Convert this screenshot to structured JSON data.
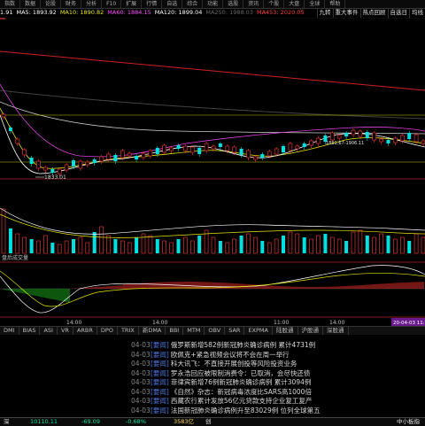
{
  "topbar": {
    "items": [
      "指数",
      "数据",
      "论股",
      "财务",
      "分析",
      "F10",
      "扩展",
      "行情",
      "自选",
      "综合",
      "功能",
      "选股",
      "资讯",
      "个股",
      "大盘",
      "全球",
      "帮助"
    ]
  },
  "ma_bar": {
    "items": [
      {
        "text": "1.91",
        "color": "#ffffff"
      },
      {
        "text": "MA5: 1893.92",
        "color": "#ffffff"
      },
      {
        "text": "MA10: 1890.82",
        "color": "#e6e600"
      },
      {
        "text": "MA60: 1884.15",
        "color": "#ff4cff"
      },
      {
        "text": "MA120: 1899.04",
        "color": "#ffffff"
      },
      {
        "text": "MA250: 1988.03",
        "color": "#666666"
      },
      {
        "text": "MA453: 2020.05",
        "color": "#ff4040"
      }
    ]
  },
  "right_tabs": [
    "九转",
    "重大事件",
    "热点回顾",
    "自选日",
    "均线"
  ],
  "price_panel": {
    "low_label": "1833.01",
    "high_label": "1891.67-1906.11"
  },
  "volume_panel": {
    "label": "盘后成交量"
  },
  "macd_panel": {
    "label": ""
  },
  "time_axis": {
    "labels": [
      "14:00",
      "14:00",
      "11:00",
      "14:00"
    ],
    "right_label": "20-04-03 11:"
  },
  "indicator_tabs": [
    "DMI",
    "BIAS",
    "ASI",
    "VR",
    "ARBR",
    "DPO",
    "TRIX",
    "新DMA",
    "BBI",
    "MTM",
    "OBV",
    "SAR",
    "EXPMA",
    "陆股通",
    "沪股通",
    "深股通"
  ],
  "news": [
    {
      "date": "04-03",
      "tag": "[要闻]",
      "text": "俄罗斯新增582例新冠肺炎确诊病例 累计4731例"
    },
    {
      "date": "04-03",
      "tag": "[要闻]",
      "text": "欧佩克+紧急视频会议将不会在周一举行"
    },
    {
      "date": "04-03",
      "tag": "[要闻]",
      "text": "科大讯飞：不直接开展创投等风险投资业务"
    },
    {
      "date": "04-03",
      "tag": "[要闻]",
      "text": "罗永浩回应被限制消费令：已取消，会尽快还债"
    },
    {
      "date": "04-03",
      "tag": "[要闻]",
      "text": "菲律宾新增76例新冠肺炎确诊病例 累计3094例"
    },
    {
      "date": "04-03",
      "tag": "[要闻]",
      "text": "《自然》杂志：新冠病毒浓度比SARS高1000倍"
    },
    {
      "date": "04-03",
      "tag": "[要闻]",
      "text": "西藏农行累计发放56亿元贷款支持企业复工复产"
    },
    {
      "date": "04-03",
      "tag": "[要闻]",
      "text": "法国新冠肺炎确诊病例升至83029例 位列全球第五"
    }
  ],
  "bottom_bar": {
    "market": "深",
    "index_value": "10110.11",
    "change": "-69.09",
    "change_pct": "-0.68%",
    "volume": "3583亿",
    "board": "创",
    "right_label": "中小板指"
  },
  "colors": {
    "up": "#ff3b3b",
    "down": "#00e0e0",
    "news_tag": "#4b74d6"
  }
}
